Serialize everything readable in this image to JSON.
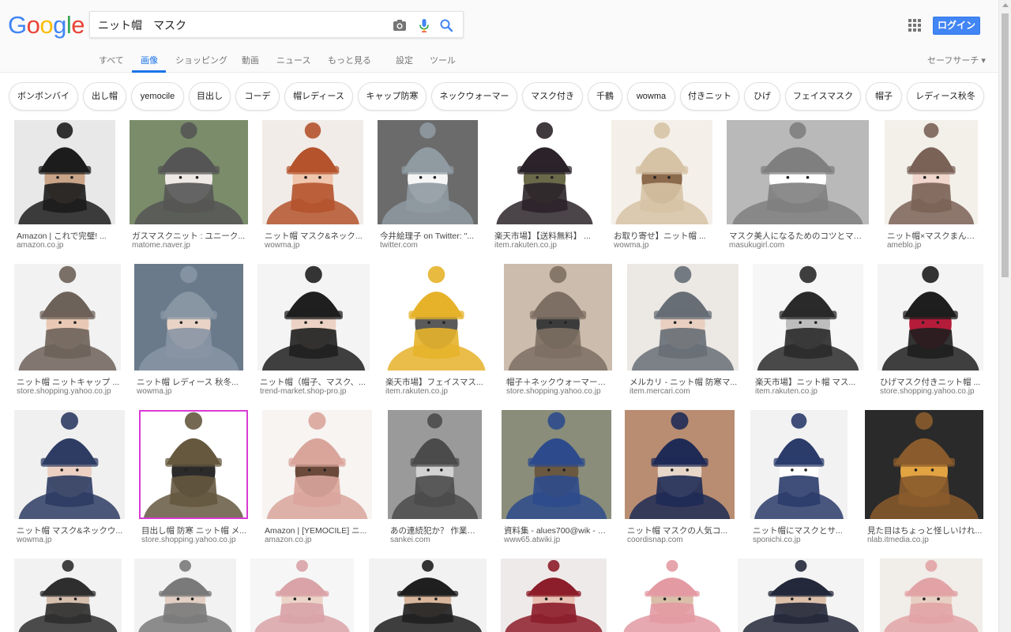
{
  "logo": [
    "G",
    "o",
    "o",
    "g",
    "l",
    "e"
  ],
  "search": {
    "value": "ニット帽　マスク",
    "icons": [
      "camera-icon",
      "mic-icon",
      "search-icon"
    ]
  },
  "header": {
    "login_label": "ログイン",
    "safesearch_label": "セーフサーチ ▾"
  },
  "tabs": [
    {
      "label": "すべて",
      "active": false
    },
    {
      "label": "画像",
      "active": true
    },
    {
      "label": "ショッピング",
      "active": false
    },
    {
      "label": "動画",
      "active": false
    },
    {
      "label": "ニュース",
      "active": false
    },
    {
      "label": "もっと見る",
      "active": false
    },
    {
      "label": "設定",
      "active": false
    },
    {
      "label": "ツール",
      "active": false
    }
  ],
  "chips": [
    "ボンボンバイ",
    "出し帽",
    "yemocile",
    "目出し",
    "コーデ",
    "帽レディース",
    "キャップ防寒",
    "ネックウォーマー",
    "マスク付き",
    "千鶴",
    "wowma",
    "付きニット",
    "ひげ",
    "フェイスマスク",
    "帽子",
    "レディース秋冬"
  ],
  "rows": [
    [
      {
        "title": "Amazon | これで完璧! ...",
        "site": "amazon.co.jp",
        "colors": [
          "#e8e8e8",
          "#1c1c1c",
          "#caa488"
        ]
      },
      {
        "title": "ガスマスクニット : ユニーク...",
        "site": "matome.naver.jp",
        "colors": [
          "#7a8c6a",
          "#555555",
          "#efe9e6"
        ]
      },
      {
        "title": "ニット帽 マスク&ネック...",
        "site": "wowma.jp",
        "colors": [
          "#f1ece8",
          "#b4532c",
          "#f0c6ae"
        ]
      },
      {
        "title": "今井絵理子 on Twitter: \"...",
        "site": "twitter.com",
        "colors": [
          "#6b6b6b",
          "#8f9aa1",
          "#f6f6f6"
        ]
      },
      {
        "title": "楽天市場】【送料無料】 ...",
        "site": "item.rakuten.co.jp",
        "colors": [
          "#ffffff",
          "#2b2329",
          "#6a6a4a"
        ]
      },
      {
        "title": "お取り寄せ】ニット帽 ...",
        "site": "wowma.jp",
        "colors": [
          "#f4efe8",
          "#d6c3a5",
          "#8c6a4c"
        ]
      },
      {
        "title": "マスク美人になるためのコツとマス...",
        "site": "masukugirl.com",
        "colors": [
          "#b9b9b9",
          "#7f7f7f",
          "#ffffff"
        ]
      },
      {
        "title": "ニット帽×マスクまん | ...",
        "site": "ameblo.jp",
        "colors": [
          "#f3efe9",
          "#7a6257",
          "#f0d6cc"
        ]
      }
    ],
    [
      {
        "title": "ニット帽 ニットキャップ ...",
        "site": "store.shopping.yahoo.co.jp",
        "colors": [
          "#f2f2f2",
          "#6d6259",
          "#e9c9b5"
        ]
      },
      {
        "title": "ニット帽 レディース 秋冬...",
        "site": "wowma.jp",
        "colors": [
          "#6a7a8a",
          "#8895a3",
          "#e9d3c6"
        ]
      },
      {
        "title": "ニット帽（帽子、マスク、...",
        "site": "trend-market.shop-pro.jp",
        "colors": [
          "#f4f4f4",
          "#1f1f1f",
          "#ecd2c4"
        ]
      },
      {
        "title": "楽天市場】フェイスマス...",
        "site": "item.rakuten.co.jp",
        "colors": [
          "#ffffff",
          "#e6b22a",
          "#5a5a5a"
        ]
      },
      {
        "title": "帽子＋ネックウォーマーの...",
        "site": "store.shopping.yahoo.co.jp",
        "colors": [
          "#cbbcae",
          "#7d6f63",
          "#3b3b3b"
        ]
      },
      {
        "title": "メルカリ - ニット帽 防寒マ...",
        "site": "item.mercari.com",
        "colors": [
          "#ece8e4",
          "#676e76",
          "#e9cfc0"
        ]
      },
      {
        "title": "楽天市場】ニット帽 マス...",
        "site": "item.rakuten.co.jp",
        "colors": [
          "#f6f6f6",
          "#2a2a2a",
          "#bdbdbd"
        ]
      },
      {
        "title": "ひげマスク付きニット帽 ...",
        "site": "store.shopping.yahoo.co.jp",
        "colors": [
          "#f4f4f4",
          "#1e1e1e",
          "#b51c3a"
        ]
      }
    ],
    [
      {
        "title": "ニット帽 マスク&ネックウ...",
        "site": "wowma.jp",
        "colors": [
          "#f0f0f0",
          "#2e3c63",
          "#ecd0c2"
        ]
      },
      {
        "title": "目出し帽 防寒 ニット帽 メ...",
        "site": "store.shopping.yahoo.co.jp",
        "colors": [
          "#ffffff",
          "#65583f",
          "#2b2b2b"
        ]
      },
      {
        "title": "Amazon | [YEMOCILE] ニ...",
        "site": "amazon.co.jp",
        "colors": [
          "#f7f4f2",
          "#d9a59b",
          "#6b4a3c"
        ]
      },
      {
        "title": "あの連続犯か？ 作業服...",
        "site": "sankei.com",
        "colors": [
          "#9a9a9a",
          "#4b4b4b",
          "#d2d2d2"
        ]
      },
      {
        "title": "資料集 - alues700@wik - アッ...",
        "site": "www65.atwiki.jp",
        "colors": [
          "#8a8d7a",
          "#2d4b8c",
          "#6a5840"
        ]
      },
      {
        "title": "ニット帽 マスクの人気コ...",
        "site": "coordisnap.com",
        "colors": [
          "#b98d72",
          "#1f2b55",
          "#e7d7c9"
        ]
      },
      {
        "title": "ニット帽にマスクとサ...",
        "site": "sponichi.co.jp",
        "colors": [
          "#f2f2f2",
          "#2b3c6b",
          "#ffffff"
        ]
      },
      {
        "title": "見た目はちょっと怪しいけれ...",
        "site": "nlab.itmedia.co.jp",
        "colors": [
          "#2a2a2a",
          "#8a5b2c",
          "#e2a343"
        ]
      }
    ],
    [
      {
        "title": "",
        "site": "",
        "colors": [
          "#f2f2f2",
          "#2e2e2e",
          "#d7bfae"
        ]
      },
      {
        "title": "",
        "site": "",
        "colors": [
          "#f2f2f2",
          "#7a7a7a",
          "#e3cfc3"
        ]
      },
      {
        "title": "",
        "site": "",
        "colors": [
          "#f6f6f6",
          "#d9a3a7",
          "#ecd4c8"
        ]
      },
      {
        "title": "",
        "site": "",
        "colors": [
          "#f2f2f2",
          "#1f1f1f",
          "#d9b79c"
        ]
      },
      {
        "title": "",
        "site": "",
        "colors": [
          "#efeaea",
          "#8c1d2a",
          "#e8c2b4"
        ]
      },
      {
        "title": "",
        "site": "",
        "colors": [
          "#ffffff",
          "#e39aa3",
          "#d9bfa9"
        ]
      },
      {
        "title": "",
        "site": "",
        "colors": [
          "#f4f4f4",
          "#23283a",
          "#dcc0aa"
        ]
      },
      {
        "title": "",
        "site": "",
        "colors": [
          "#f1ede9",
          "#e2a3a6",
          "#e8cfc4"
        ]
      }
    ]
  ]
}
